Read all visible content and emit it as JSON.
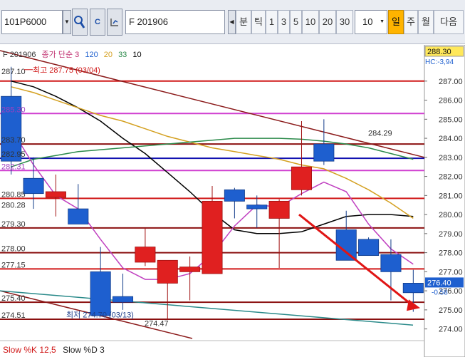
{
  "toolbar": {
    "code": "101P6000",
    "search_icon_label": "Q",
    "c_icon_label": "C",
    "name": "F 201906",
    "periods": [
      "분",
      "틱",
      "1",
      "3",
      "5",
      "10",
      "20",
      "30"
    ],
    "interval_value": "10",
    "period_day": "일",
    "period_week": "주",
    "period_month": "월",
    "next_label": "다음"
  },
  "legend": {
    "symbol": "F 201906",
    "indicator": "종가 단순 3",
    "ma120": "120",
    "ma20": "20",
    "ma33": "33",
    "ma10": "10"
  },
  "colors": {
    "ma120": "#000000",
    "ma20": "#d4a020",
    "ma33": "#2b8a4a",
    "ma10": "#c040c0",
    "up": "#e02020",
    "down": "#1e5fcf"
  },
  "price_axis": {
    "min": 273.5,
    "max": 288.6,
    "ticks": [
      "287.00",
      "286.00",
      "285.00",
      "284.00",
      "283.00",
      "282.00",
      "281.00",
      "280.00",
      "279.00",
      "278.00",
      "277.00",
      "276.00",
      "275.00",
      "274.00"
    ],
    "current_price": "288.30",
    "hc_label": "HC:-3,94",
    "last_price": "276.40",
    "last_change": "-0.58"
  },
  "level_labels": [
    {
      "price": 287.3,
      "text": "287.10",
      "color": "#333333"
    },
    {
      "price": 285.3,
      "text": "285.30",
      "color": "#a040c0"
    },
    {
      "price": 283.7,
      "text": "283.70",
      "color": "#333333"
    },
    {
      "price": 282.95,
      "text": "282.95",
      "color": "#333333"
    },
    {
      "price": 282.31,
      "text": "282.31",
      "color": "#a040c0"
    },
    {
      "price": 280.85,
      "text": "280.85",
      "color": "#333333"
    },
    {
      "price": 280.28,
      "text": "280.28",
      "color": "#333333"
    },
    {
      "price": 279.3,
      "text": "279.30",
      "color": "#333333"
    },
    {
      "price": 278.0,
      "text": "278.00",
      "color": "#333333"
    },
    {
      "price": 277.15,
      "text": "277.15",
      "color": "#333333"
    },
    {
      "price": 275.4,
      "text": "275.40",
      "color": "#333333"
    },
    {
      "price": 274.51,
      "text": "274.51",
      "color": "#333333"
    }
  ],
  "annotations": {
    "high": "최고 287.75 (03/04)",
    "low": "최저 274.70 (03/13)",
    "trendline_value": "284.29",
    "low_tag": "274.47"
  },
  "oscillator": {
    "k_label": "Slow %K 12,5",
    "d_label": "Slow %D 3"
  },
  "chart_data": {
    "type": "candlestick",
    "ylim": [
      273.5,
      288.6
    ],
    "candles": [
      {
        "o": 286.2,
        "h": 287.75,
        "l": 282.1,
        "c": 282.8
      },
      {
        "o": 281.9,
        "h": 283.0,
        "l": 280.3,
        "c": 281.1
      },
      {
        "o": 280.9,
        "h": 282.1,
        "l": 279.9,
        "c": 281.2
      },
      {
        "o": 280.3,
        "h": 281.6,
        "l": 279.5,
        "c": 279.5
      },
      {
        "o": 277.0,
        "h": 278.3,
        "l": 275.2,
        "c": 274.7
      },
      {
        "o": 275.7,
        "h": 276.9,
        "l": 275.0,
        "c": 275.4
      },
      {
        "o": 277.5,
        "h": 279.3,
        "l": 277.3,
        "c": 278.3
      },
      {
        "o": 276.4,
        "h": 277.6,
        "l": 274.47,
        "c": 277.6
      },
      {
        "o": 277.0,
        "h": 277.8,
        "l": 275.5,
        "c": 277.25
      },
      {
        "o": 276.9,
        "h": 281.5,
        "l": 276.9,
        "c": 280.7
      },
      {
        "o": 281.3,
        "h": 281.4,
        "l": 279.8,
        "c": 280.7
      },
      {
        "o": 280.5,
        "h": 281.0,
        "l": 279.3,
        "c": 280.3
      },
      {
        "o": 279.8,
        "h": 280.8,
        "l": 277.2,
        "c": 280.7
      },
      {
        "o": 281.3,
        "h": 284.9,
        "l": 281.0,
        "c": 282.5
      },
      {
        "o": 283.7,
        "h": 285.0,
        "l": 282.6,
        "c": 282.8
      },
      {
        "o": 279.2,
        "h": 280.2,
        "l": 278.1,
        "c": 277.6
      },
      {
        "o": 278.7,
        "h": 278.8,
        "l": 277.9,
        "c": 277.85
      },
      {
        "o": 277.9,
        "h": 278.7,
        "l": 275.5,
        "c": 277.0
      },
      {
        "o": 276.4,
        "h": 277.1,
        "l": 274.9,
        "c": 275.9
      }
    ],
    "ma120": [
      287.0,
      286.7,
      286.2,
      285.6,
      284.9,
      284.0,
      283.2,
      282.2,
      281.2,
      280.1,
      279.2,
      279.0,
      279.0,
      279.1,
      279.5,
      279.9,
      280.0,
      280.0,
      279.9
    ],
    "ma20": [
      286.7,
      286.4,
      286.0,
      285.6,
      285.2,
      284.9,
      284.5,
      284.1,
      283.8,
      283.5,
      283.3,
      283.1,
      282.9,
      282.6,
      282.4,
      281.9,
      281.3,
      280.6,
      279.8
    ],
    "ma33": [
      282.5,
      282.9,
      283.1,
      283.3,
      283.4,
      283.5,
      283.6,
      283.7,
      283.8,
      283.9,
      284.0,
      284.0,
      284.0,
      283.95,
      283.85,
      283.7,
      283.5,
      283.2,
      282.9
    ],
    "ma10": [
      284.5,
      282.6,
      281.0,
      280.3,
      278.7,
      277.2,
      276.6,
      276.6,
      276.9,
      277.9,
      279.4,
      280.5,
      280.4,
      281.1,
      281.7,
      281.2,
      279.5,
      278.2,
      277.4
    ],
    "horizontal_lines": [
      {
        "price": 287.0,
        "color": "#d01818"
      },
      {
        "price": 285.3,
        "color": "#d040d0"
      },
      {
        "price": 283.7,
        "color": "#8b1010"
      },
      {
        "price": 282.95,
        "color": "#1010b0"
      },
      {
        "price": 282.31,
        "color": "#d040d0"
      },
      {
        "price": 280.85,
        "color": "#d01818"
      },
      {
        "price": 279.3,
        "color": "#8b1010"
      },
      {
        "price": 278.0,
        "color": "#8b1010"
      },
      {
        "price": 277.15,
        "color": "#d01818"
      },
      {
        "price": 275.4,
        "color": "#8b1010"
      },
      {
        "price": 274.51,
        "color": "#8b1010"
      }
    ]
  }
}
